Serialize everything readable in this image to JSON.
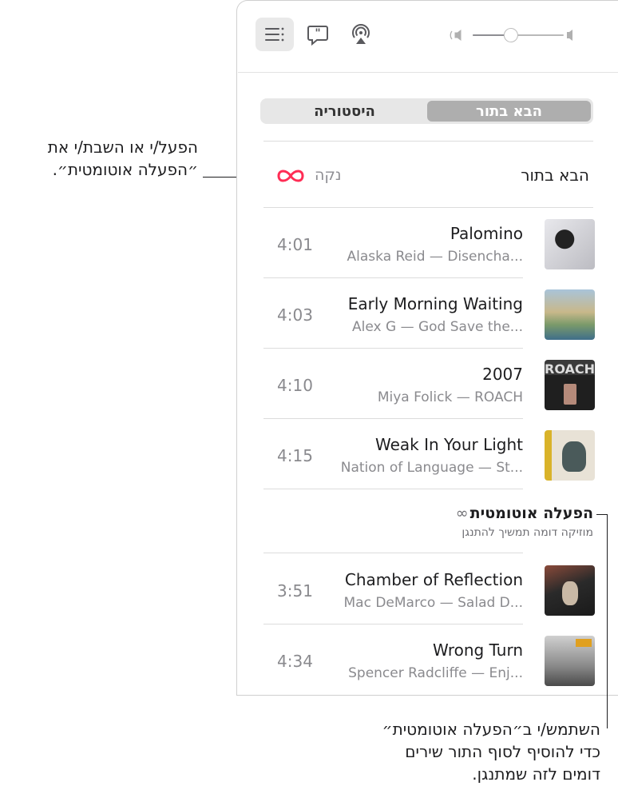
{
  "toolbar": {
    "buttons": [
      "playing-next-icon",
      "lyrics-icon",
      "airplay-icon"
    ],
    "volume_level": 0.42
  },
  "tabs": {
    "selected": "הבא בתור",
    "other": "היסטוריה"
  },
  "section": {
    "title": "הבא בתור",
    "clear": "נקה",
    "autoplay_icon": "∞",
    "autoplay_color": "#ff2d55"
  },
  "queue": [
    {
      "title": "Palomino",
      "subtitle": "Alaska Reid — Disencha...",
      "duration": "4:01"
    },
    {
      "title": "Early Morning Waiting",
      "subtitle": "Alex G — God Save the...",
      "duration": "4:03"
    },
    {
      "title": "2007",
      "subtitle": "Miya Folick — ROACH",
      "duration": "4:10"
    },
    {
      "title": "Weak In Your Light",
      "subtitle": "Nation of Language — St...",
      "duration": "4:15"
    }
  ],
  "autoplay": {
    "heading": "הפעלה אוטומטית",
    "icon": "∞",
    "subheading": "מוזיקה דומה תמשיך להתנגן",
    "tracks": [
      {
        "title": "Chamber of Reflection",
        "subtitle": "Mac DeMarco — Salad D...",
        "duration": "3:51"
      },
      {
        "title": "Wrong Turn",
        "subtitle": "Spencer Radcliffe — Enj...",
        "duration": "4:34"
      }
    ]
  },
  "callouts": {
    "top_line1": "הפעל/י או השבת/י את",
    "top_line2": "״הפעלה אוטומטית״.",
    "bottom_line1": "השתמש/י ב״הפעלה אוטומטית״",
    "bottom_line2": "כדי להוסיף לסוף התור שירים",
    "bottom_line3": "דומים לזה שמתנגן."
  }
}
